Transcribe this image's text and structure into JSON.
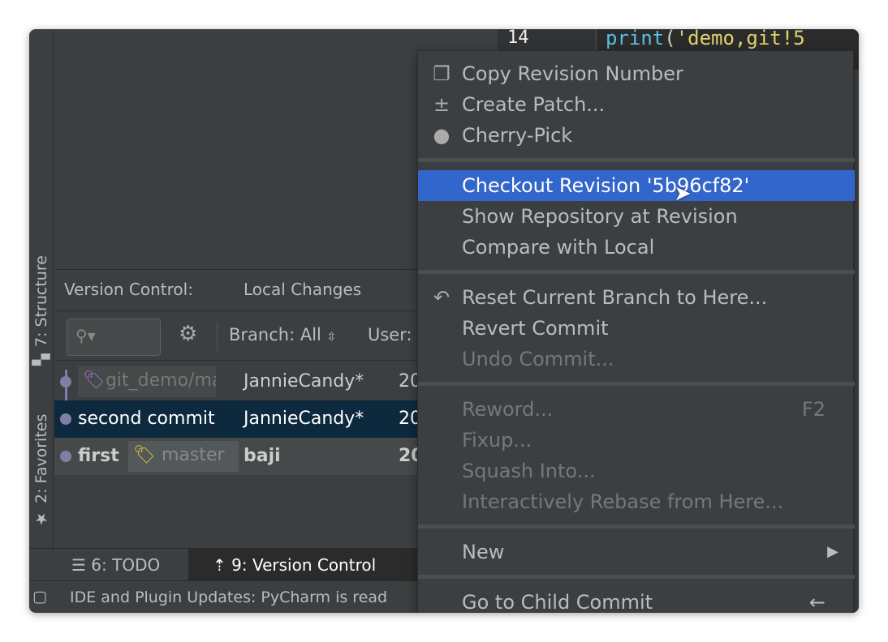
{
  "editor": {
    "line_number": "14",
    "code_fn": "print",
    "code_paren": "(",
    "code_str": "'demo,git!5"
  },
  "side_tabs": {
    "structure": "7: Structure",
    "favorites": "2: Favorites"
  },
  "vc": {
    "title": "Version Control:",
    "tab_local": "Local Changes",
    "branch": "Branch: All",
    "user": "User:"
  },
  "log": [
    {
      "ref": "git_demo/mas",
      "author": "JannieCandy*",
      "date": "20"
    },
    {
      "message": "second commit",
      "author": "JannieCandy*",
      "date": "20"
    },
    {
      "message": "first",
      "ref": "master",
      "author": "baji",
      "date": "20"
    }
  ],
  "bottom": {
    "todo": "6: TODO",
    "vc": "9: Version Control"
  },
  "status": "IDE and Plugin Updates: PyCharm is read",
  "menu": {
    "copy": "Copy Revision Number",
    "patch": "Create Patch...",
    "cherry": "Cherry-Pick",
    "checkout": "Checkout Revision '5b96cf82'",
    "show": "Show Repository at Revision",
    "compare": "Compare with Local",
    "reset": "Reset Current Branch to Here...",
    "revert": "Revert Commit",
    "undo": "Undo Commit...",
    "reword": "Reword...",
    "reword_shortcut": "F2",
    "fixup": "Fixup...",
    "squash": "Squash Into...",
    "rebase": "Interactively Rebase from Here...",
    "new": "New",
    "child": "Go to Child Commit",
    "child_shortcut": "←"
  },
  "colors": {
    "highlight": "#3366cc",
    "selected_row": "#0d293e",
    "tag_purple": "#a36bc4",
    "tag_yellow": "#d9c23a",
    "tag_green": "#3cb04a"
  }
}
